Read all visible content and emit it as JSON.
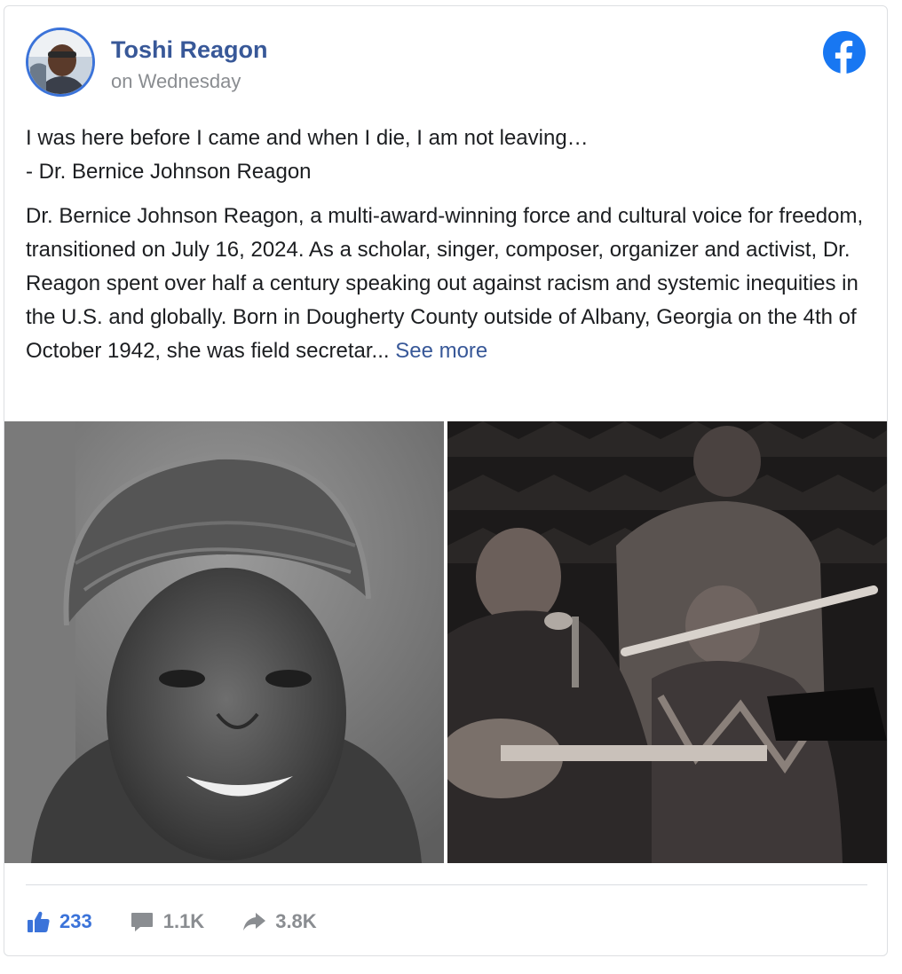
{
  "post": {
    "author": "Toshi Reagon",
    "timestamp": "on Wednesday",
    "quote_line_1": "I was here before I came and when I die, I am not leaving…",
    "quote_line_2": "- Dr. Bernice Johnson Reagon",
    "body": "Dr. Bernice Johnson Reagon, a multi-award-winning force and cultural voice for freedom, transitioned on July 16, 2024. As a scholar, singer, composer, organizer and activist, Dr. Reagon spent over half a century speaking out against racism and systemic inequities in the U.S. and globally. Born in Dougherty County outside of Albany, Georgia on the 4th of October 1942, she was field secretar...",
    "see_more": "See more"
  },
  "photos": [
    {
      "icon": "portrait-photo"
    },
    {
      "icon": "concert-photo"
    }
  ],
  "engagement": {
    "likes": "233",
    "comments": "1.1K",
    "shares": "3.8K"
  },
  "colors": {
    "brand": "#1877f2",
    "author_link": "#385898",
    "muted": "#8a8d91",
    "like": "#3b73d9"
  }
}
